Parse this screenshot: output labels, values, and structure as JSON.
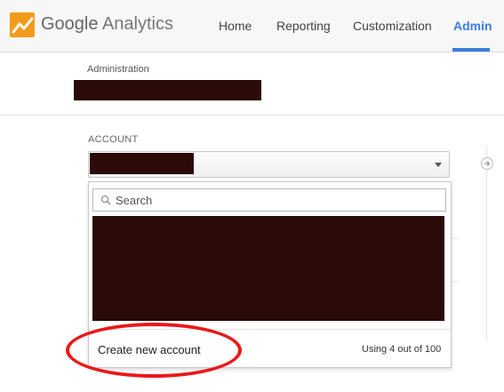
{
  "header": {
    "brand_google": "Google",
    "brand_analytics": "Analytics",
    "logo_icon": "analytics-logo-icon",
    "nav": [
      {
        "label": "Home",
        "active": false
      },
      {
        "label": "Reporting",
        "active": false
      },
      {
        "label": "Customization",
        "active": false
      },
      {
        "label": "Admin",
        "active": true
      }
    ],
    "accent_color": "#3b7ddd"
  },
  "admin": {
    "section_label": "Administration",
    "account_name_redacted": true
  },
  "account": {
    "label": "ACCOUNT",
    "selected_value_redacted": true
  },
  "dropdown": {
    "search_placeholder": "Search",
    "search_value": "",
    "account_list_redacted": true,
    "create_label": "Create new account",
    "usage_text": "Using 4 out of 100"
  },
  "annotation": {
    "highlight_color": "#e8191a"
  }
}
